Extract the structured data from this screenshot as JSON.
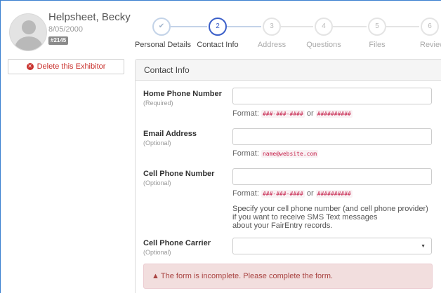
{
  "profile": {
    "name": "Helpsheet, Becky",
    "dob": "8/05/2000",
    "badge": "#2145"
  },
  "delete_button": {
    "label": "Delete this Exhibitor"
  },
  "stepper": {
    "steps": [
      {
        "number": "✔",
        "label": "Personal Details",
        "state": "done"
      },
      {
        "number": "2",
        "label": "Contact Info",
        "state": "active"
      },
      {
        "number": "3",
        "label": "Address",
        "state": "todo"
      },
      {
        "number": "4",
        "label": "Questions",
        "state": "todo"
      },
      {
        "number": "5",
        "label": "Files",
        "state": "todo"
      },
      {
        "number": "6",
        "label": "Review",
        "state": "todo"
      }
    ]
  },
  "panel": {
    "title": "Contact Info",
    "fields": [
      {
        "label": "Home Phone Number",
        "sub": "(Required)",
        "value": "",
        "format_prefix": "Format:",
        "format_code1": "###-###-####",
        "format_or": "or",
        "format_code2": "##########"
      },
      {
        "label": "Email Address",
        "sub": "(Optional)",
        "value": "",
        "format_prefix": "Format:",
        "format_code1": "name@website.com"
      },
      {
        "label": "Cell Phone Number",
        "sub": "(Optional)",
        "value": "",
        "format_prefix": "Format:",
        "format_code1": "###-###-####",
        "format_or": "or",
        "format_code2": "##########",
        "help_line1": "Specify your cell phone number (and cell phone provider)",
        "help_line2": "if you want to receive SMS Text messages",
        "help_line3": "about your FairEntry records."
      },
      {
        "label": "Cell Phone Carrier",
        "sub": "(Optional)",
        "selected": ""
      }
    ],
    "alert": "The form is incomplete. Please complete the form."
  },
  "colors": {
    "accent": "#3b5fc9",
    "danger": "#c9302c",
    "alert_bg": "#f2dede",
    "alert_text": "#a94442",
    "code_text": "#c7254e"
  }
}
